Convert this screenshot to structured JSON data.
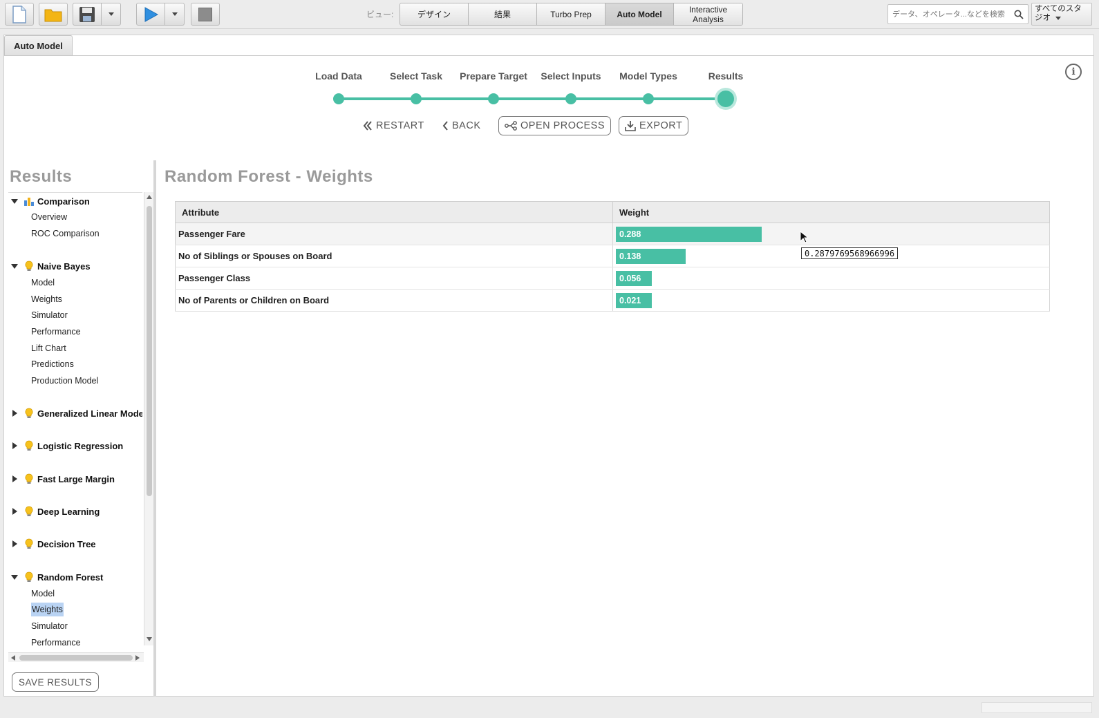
{
  "toolbar": {
    "view_label": "ビュー:",
    "view_tabs": [
      {
        "label": "デザイン"
      },
      {
        "label": "結果"
      },
      {
        "label": "Turbo Prep"
      },
      {
        "label": "Auto Model"
      },
      {
        "label": "Interactive Analysis"
      }
    ],
    "active_view": "Auto Model",
    "search_placeholder": "データ、オペレータ...などを検索",
    "studio_dropdown": "すべてのスタジオ"
  },
  "panel": {
    "tab_label": "Auto Model"
  },
  "wizard": {
    "steps": [
      "Load Data",
      "Select Task",
      "Prepare Target",
      "Select Inputs",
      "Model Types",
      "Results"
    ],
    "current_step": "Results",
    "restart_label": "RESTART",
    "back_label": "BACK",
    "open_process_label": "OPEN PROCESS",
    "export_label": "EXPORT"
  },
  "sidebar": {
    "title": "Results",
    "groups": [
      {
        "label": "Comparison",
        "icon": "chart-icon",
        "expanded": true,
        "items": [
          "Overview",
          "ROC Comparison"
        ]
      },
      {
        "label": "Naive Bayes",
        "icon": "lightbulb-icon",
        "expanded": true,
        "items": [
          "Model",
          "Weights",
          "Simulator",
          "Performance",
          "Lift Chart",
          "Predictions",
          "Production Model"
        ]
      },
      {
        "label": "Generalized Linear Model",
        "icon": "lightbulb-icon",
        "expanded": false,
        "items": []
      },
      {
        "label": "Logistic Regression",
        "icon": "lightbulb-icon",
        "expanded": false,
        "items": []
      },
      {
        "label": "Fast Large Margin",
        "icon": "lightbulb-icon",
        "expanded": false,
        "items": []
      },
      {
        "label": "Deep Learning",
        "icon": "lightbulb-icon",
        "expanded": false,
        "items": []
      },
      {
        "label": "Decision Tree",
        "icon": "lightbulb-icon",
        "expanded": false,
        "items": []
      },
      {
        "label": "Random Forest",
        "icon": "lightbulb-icon",
        "expanded": true,
        "items": [
          "Model",
          "Weights",
          "Simulator",
          "Performance"
        ]
      }
    ],
    "selected": "Random Forest / Weights",
    "save_results_label": "SAVE RESULTS"
  },
  "content": {
    "title": "Random Forest - Weights",
    "columns": [
      "Attribute",
      "Weight"
    ],
    "rows": [
      {
        "attribute": "Passenger Fare",
        "weight_label": "0.288",
        "weight": 0.288
      },
      {
        "attribute": "No of Siblings or Spouses on Board",
        "weight_label": "0.138",
        "weight": 0.138
      },
      {
        "attribute": "Passenger Class",
        "weight_label": "0.056",
        "weight": 0.056
      },
      {
        "attribute": "No of Parents or Children on Board",
        "weight_label": "0.021",
        "weight": 0.021
      }
    ],
    "tooltip": "0.2879769568966996"
  },
  "colors": {
    "accent": "#48bfa4",
    "selection": "#b9d3f3"
  }
}
